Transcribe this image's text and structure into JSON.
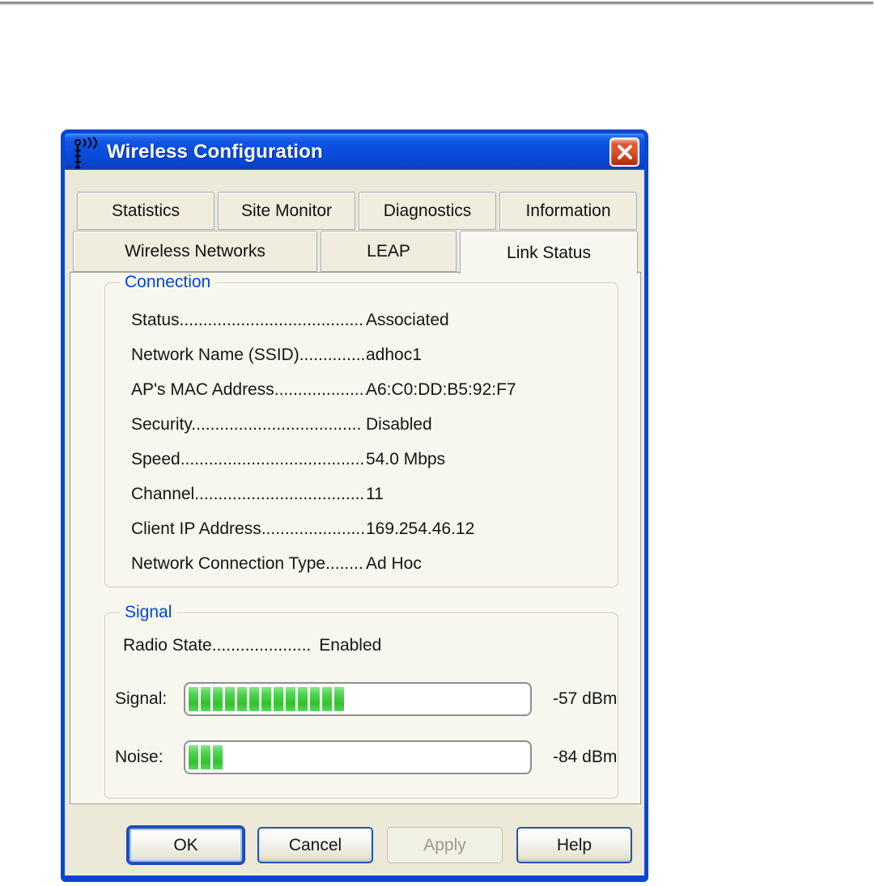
{
  "window": {
    "title": "Wireless Configuration"
  },
  "tabs": {
    "row1": [
      {
        "label": "Statistics"
      },
      {
        "label": "Site Monitor"
      },
      {
        "label": "Diagnostics"
      },
      {
        "label": "Information"
      }
    ],
    "row2": [
      {
        "label": "Wireless Networks"
      },
      {
        "label": "LEAP"
      },
      {
        "label": "Link Status",
        "active": true
      }
    ]
  },
  "connection": {
    "group_label": "Connection",
    "rows": [
      {
        "label": "Status.......................................",
        "value": "Associated"
      },
      {
        "label": "Network Name (SSID)..............",
        "value": "adhoc1"
      },
      {
        "label": "AP's MAC Address....................",
        "value": "A6:C0:DD:B5:92:F7"
      },
      {
        "label": "Security....................................",
        "value": "Disabled"
      },
      {
        "label": "Speed.......................................",
        "value": "54.0 Mbps"
      },
      {
        "label": "Channel....................................",
        "value": "11"
      },
      {
        "label": "Client IP Address......................",
        "value": "169.254.46.12"
      },
      {
        "label": "Network Connection Type........",
        "value": "Ad Hoc"
      }
    ]
  },
  "signal": {
    "group_label": "Signal",
    "radio_state": {
      "label": "Radio State.....................",
      "value": "Enabled"
    },
    "bars": [
      {
        "label": "Signal:",
        "value": "-57 dBm",
        "segments_filled": 13
      },
      {
        "label": "Noise:",
        "value": "-84 dBm",
        "segments_filled": 3
      }
    ]
  },
  "buttons": [
    {
      "label": "OK",
      "state": "focused"
    },
    {
      "label": "Cancel",
      "state": "normal"
    },
    {
      "label": "Apply",
      "state": "disabled"
    },
    {
      "label": "Help",
      "state": "normal"
    }
  ],
  "icons": {
    "titlebar": "antenna-icon",
    "close": "close-icon"
  },
  "colors": {
    "titlebar_blue": "#0A4BDC",
    "frame_blue": "#0A46D4",
    "group_label_blue": "#0046D5",
    "bar_green": "#3CCD3C",
    "close_red": "#D1461F",
    "dialog_beige": "#ECE9D8",
    "panel_bg": "#F7F6EF"
  }
}
